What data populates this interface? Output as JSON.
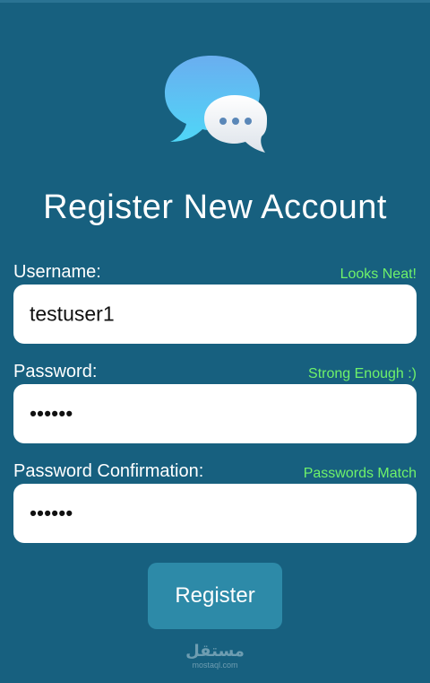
{
  "header": {
    "logo_icon": "chat-bubbles-icon",
    "title": "Register New Account"
  },
  "form": {
    "username": {
      "label": "Username:",
      "hint": "Looks Neat!",
      "value": "testuser1"
    },
    "password": {
      "label": "Password:",
      "hint": "Strong Enough :)",
      "value": "••••••"
    },
    "confirm": {
      "label": "Password Confirmation:",
      "hint": "Passwords Match",
      "value": "••••••"
    }
  },
  "actions": {
    "register_label": "Register"
  },
  "watermark": {
    "main": "مستقل",
    "sub": "mostaql.com"
  },
  "colors": {
    "background": "#17607f",
    "hint": "#6ff26a",
    "button": "#2d8aa8"
  }
}
